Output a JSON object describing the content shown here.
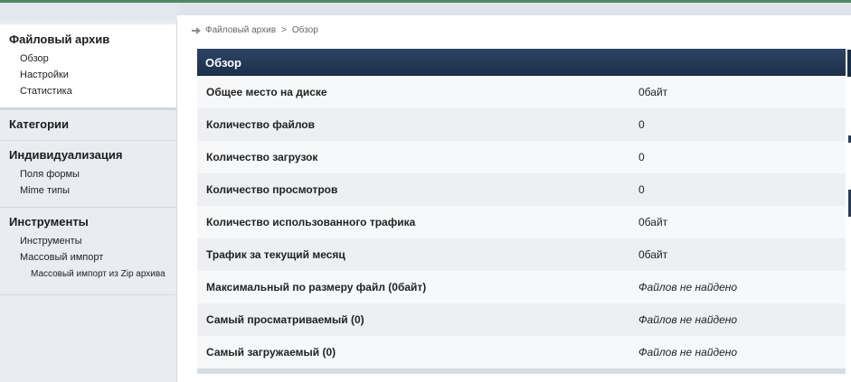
{
  "breadcrumb": {
    "root": "Файловый архив",
    "separator": ">",
    "current": "Обзор"
  },
  "sidebar": {
    "sections": [
      {
        "title": "Файловый архив",
        "items": [
          "Обзор",
          "Настройки",
          "Статистика"
        ]
      },
      {
        "title": "Категории",
        "items": []
      },
      {
        "title": "Индивидуализация",
        "items": [
          "Поля формы",
          "Mime типы"
        ]
      },
      {
        "title": "Инструменты",
        "items": [
          "Инструменты",
          "Массовый импорт"
        ],
        "subitems": [
          "Массовый импорт из Zip архива"
        ]
      }
    ]
  },
  "panel": {
    "title": "Обзор",
    "rows": [
      {
        "label": "Общее место на диске",
        "value": "0байт"
      },
      {
        "label": "Количество файлов",
        "value": "0"
      },
      {
        "label": "Количество загрузок",
        "value": "0"
      },
      {
        "label": "Количество просмотров",
        "value": "0"
      },
      {
        "label": "Количество использованного трафика",
        "value": "0байт"
      },
      {
        "label": "Трафик за текущий месяц",
        "value": "0байт"
      },
      {
        "label": "Максимальный по размеру файл (0байт)",
        "value": "Файлов не найдено"
      },
      {
        "label": "Самый просматриваемый (0)",
        "value": "Файлов не найдено"
      },
      {
        "label": "Самый загружаемый (0)",
        "value": "Файлов не найдено"
      }
    ]
  },
  "colors": {
    "header": "#1b2f4a",
    "accent_line": "#4f8a5c",
    "sidebar_bg": "#e9edf2"
  }
}
